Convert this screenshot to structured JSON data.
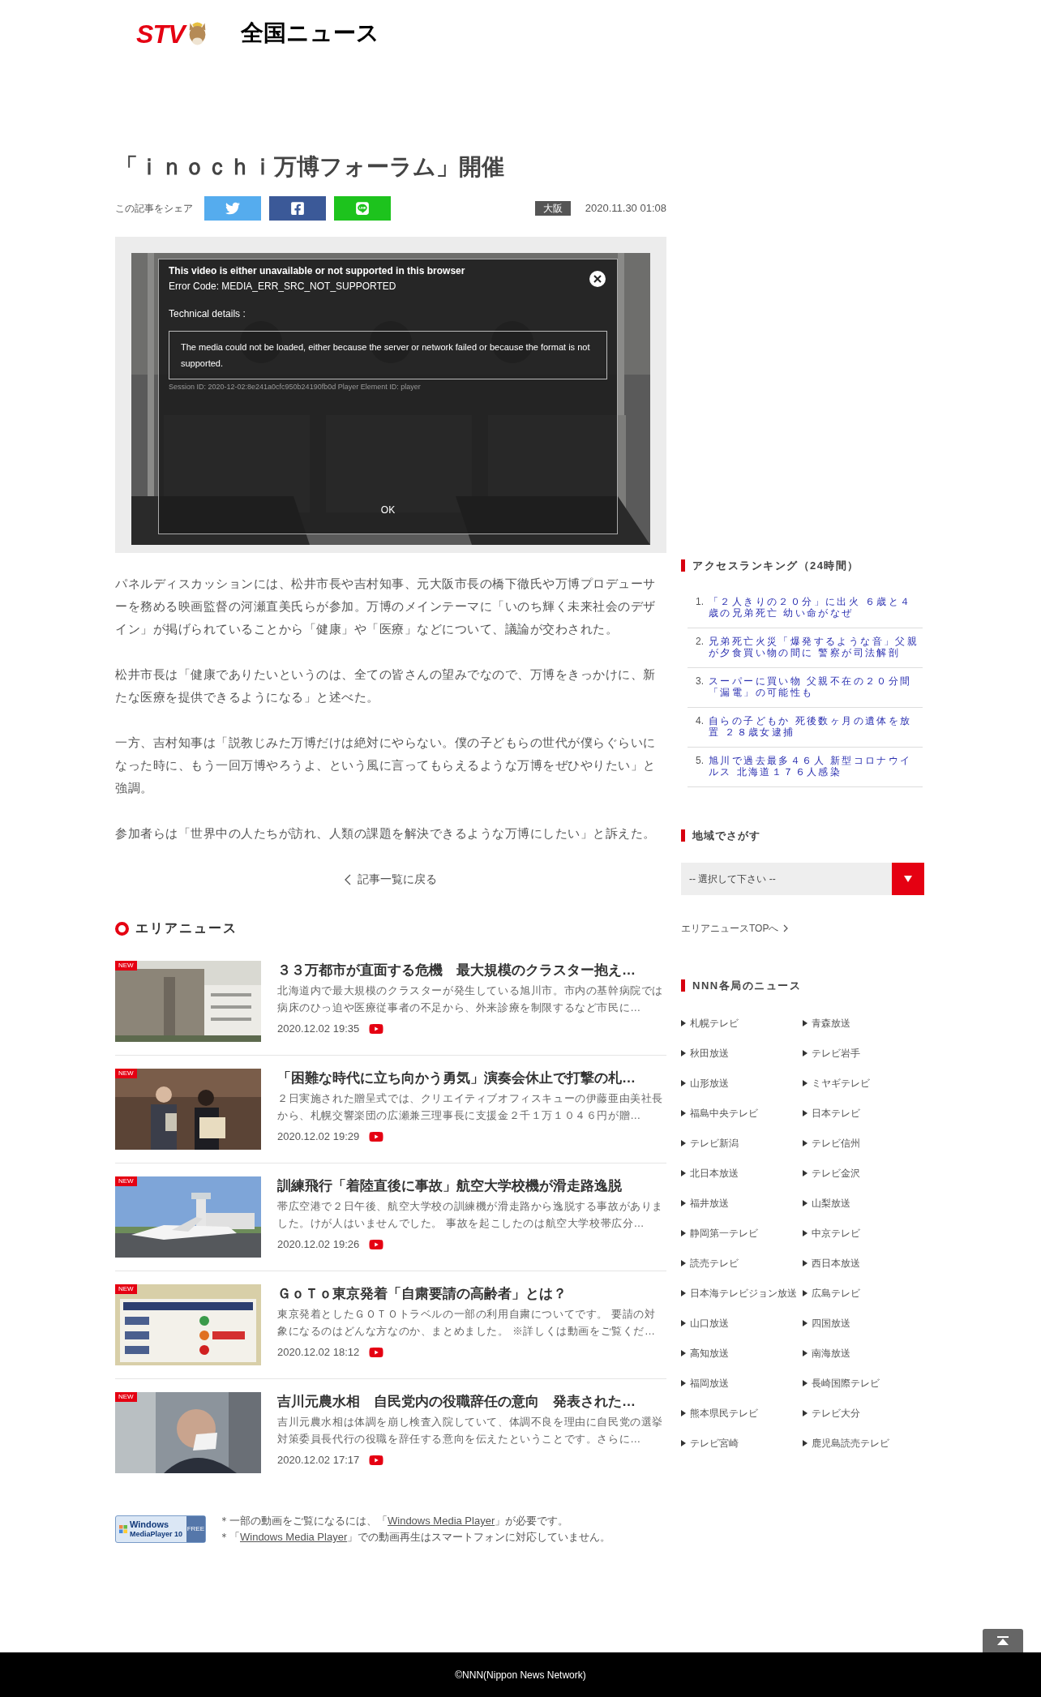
{
  "header": {
    "logo_text": "STV",
    "section_title": "全国ニュース"
  },
  "article": {
    "title": "「ｉｎｏｃｈｉ万博フォーラム」開催",
    "share_label": "この記事をシェア",
    "share_buttons": [
      {
        "kind": "twitter"
      },
      {
        "kind": "facebook"
      },
      {
        "kind": "line"
      }
    ],
    "region_tag": "大阪",
    "date": "2020.11.30 01:08",
    "video": {
      "error_title": "This video is either unavailable or not supported in this browser",
      "error_code": "Error Code: MEDIA_ERR_SRC_NOT_SUPPORTED",
      "details_label": "Technical details :",
      "message": "The media could not be loaded, either because the server or network failed or because the format is not supported.",
      "session": "Session ID: 2020-12-02:8e241a0cfc950b24190fb0d Player Element ID: player",
      "ok": "OK"
    },
    "paragraphs": [
      "パネルディスカッションには、松井市長や吉村知事、元大阪市長の橋下徹氏や万博プロデューサーを務める映画監督の河瀬直美氏らが参加。万博のメインテーマに「いのち輝く未来社会のデザイン」が掲げられていることから「健康」や「医療」などについて、議論が交わされた。",
      "松井市長は「健康でありたいというのは、全ての皆さんの望みでなので、万博をきっかけに、新たな医療を提供できるようになる」と述べた。",
      "一方、吉村知事は「説教じみた万博だけは絶対にやらない。僕の子どもらの世代が僕らぐらいになった時に、もう一回万博やろうよ、という風に言ってもらえるような万博をぜひやりたい」と強調。",
      "参加者らは「世界中の人たちが訪れ、人類の課題を解決できるような万博にしたい」と訴えた。"
    ],
    "back_link": "記事一覧に戻る"
  },
  "area_news": {
    "heading": "エリアニュース",
    "items": [
      {
        "badge": "NEW",
        "title": "３３万都市が直面する危機　最大規模のクラスター抱え…",
        "summary": "北海道内で最大規模のクラスターが発生している旭川市。市内の基幹病院では病床のひっ迫や医療従事者の不足から、外来診療を制限するなど市民に…",
        "date": "2020.12.02 19:35"
      },
      {
        "badge": "NEW",
        "title": "「困難な時代に立ち向かう勇気」演奏会休止で打撃の札…",
        "summary": "２日実施された贈呈式では、クリエイティブオフィスキューの伊藤亜由美社長から、札幌交響楽団の広瀬兼三理事長に支援金２千１万１０４６円が贈…",
        "date": "2020.12.02 19:29"
      },
      {
        "badge": "NEW",
        "title": "訓練飛行「着陸直後に事故」航空大学校機が滑走路逸脱",
        "summary": "帯広空港で２日午後、航空大学校の訓練機が滑走路から逸脱する事故がありました。けが人はいませんでした。 事故を起こしたのは航空大学校帯広分…",
        "date": "2020.12.02 19:26"
      },
      {
        "badge": "NEW",
        "title": "ＧｏＴｏ東京発着「自粛要請の高齢者」とは？",
        "summary": "東京発着としたＧＯＴＯトラベルの一部の利用自粛についてです。 要請の対象になるのはどんな方なのか、まとめました。 ※詳しくは動画をご覧くだ…",
        "date": "2020.12.02 18:12"
      },
      {
        "badge": "NEW",
        "title": "吉川元農水相　自民党内の役職辞任の意向　発表された…",
        "summary": "吉川元農水相は体調を崩し検査入院していて、体調不良を理由に自民党の選挙対策委員長代行の役職を辞任する意向を伝えたということです。さらに…",
        "date": "2020.12.02 17:17"
      }
    ]
  },
  "player_notice": {
    "badge": {
      "line1": "Windows",
      "line2": "MediaPlayer 10",
      "tag": "FREE"
    },
    "notes": [
      {
        "before": "＊一部の動画をご覧になるには、「",
        "link": "Windows Media Player",
        "after": "」が必要です。"
      },
      {
        "before": "＊「",
        "link": "Windows Media Player",
        "after": "」での動画再生はスマートフォンに対応していません。"
      }
    ]
  },
  "sidebar": {
    "ranking": {
      "heading": "アクセスランキング（24時間）",
      "items": [
        {
          "rank": "1.",
          "title": "「２人きりの２０分」に出火 ６歳と４歳の兄弟死亡 幼い命がなぜ"
        },
        {
          "rank": "2.",
          "title": "兄弟死亡火災「爆発するような音」父親が夕食買い物の間に 警察が司法解剖"
        },
        {
          "rank": "3.",
          "title": "スーパーに買い物 父親不在の２０分間「漏電」の可能性も"
        },
        {
          "rank": "4.",
          "title": "自らの子どもか 死後数ヶ月の遺体を放置 ２８歳女逮捕"
        },
        {
          "rank": "5.",
          "title": "旭川で過去最多４６人 新型コロナウイルス 北海道１７６人感染"
        }
      ]
    },
    "region_search": {
      "heading": "地域でさがす",
      "select_value": "-- 選択して下さい --",
      "top_link": "エリアニュースTOPへ"
    },
    "stations": {
      "heading": "NNN各局のニュース",
      "items": [
        "札幌テレビ",
        "青森放送",
        "秋田放送",
        "テレビ岩手",
        "山形放送",
        "ミヤギテレビ",
        "福島中央テレビ",
        "日本テレビ",
        "テレビ新潟",
        "テレビ信州",
        "北日本放送",
        "テレビ金沢",
        "福井放送",
        "山梨放送",
        "静岡第一テレビ",
        "中京テレビ",
        "読売テレビ",
        "西日本放送",
        "日本海テレビジョン放送",
        "広島テレビ",
        "山口放送",
        "四国放送",
        "高知放送",
        "南海放送",
        "福岡放送",
        "長崎国際テレビ",
        "熊本県民テレビ",
        "テレビ大分",
        "テレビ宮崎",
        "鹿児島読売テレビ"
      ]
    }
  },
  "footer": {
    "copyright": "©NNN(Nippon News Network)"
  }
}
